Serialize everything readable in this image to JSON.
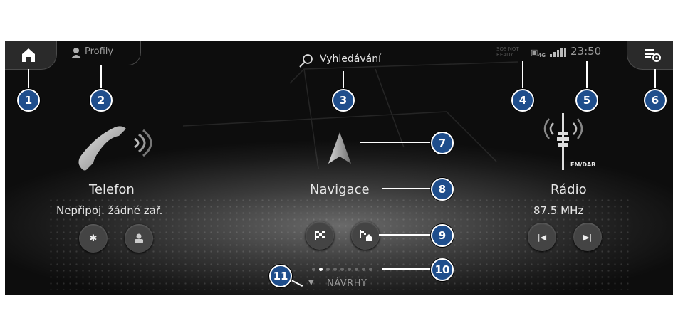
{
  "header": {
    "profiles_label": "Profily",
    "search_label": "Vyhledávání",
    "status_sos": "SOS NOT",
    "status_ready": "READY",
    "network": "4G",
    "clock": "23:50"
  },
  "tiles": {
    "phone": {
      "title": "Telefon",
      "subtitle": "Nepřipoj. žádné zař."
    },
    "navigation": {
      "title": "Navigace"
    },
    "radio": {
      "title": "Rádio",
      "band": "FM/DAB",
      "frequency": "87.5 MHz"
    }
  },
  "pager": {
    "pages": 9,
    "active_index": 1
  },
  "suggestions_label": "NÁVRHY",
  "callouts": [
    "1",
    "2",
    "3",
    "4",
    "5",
    "6",
    "7",
    "8",
    "9",
    "10",
    "11"
  ]
}
